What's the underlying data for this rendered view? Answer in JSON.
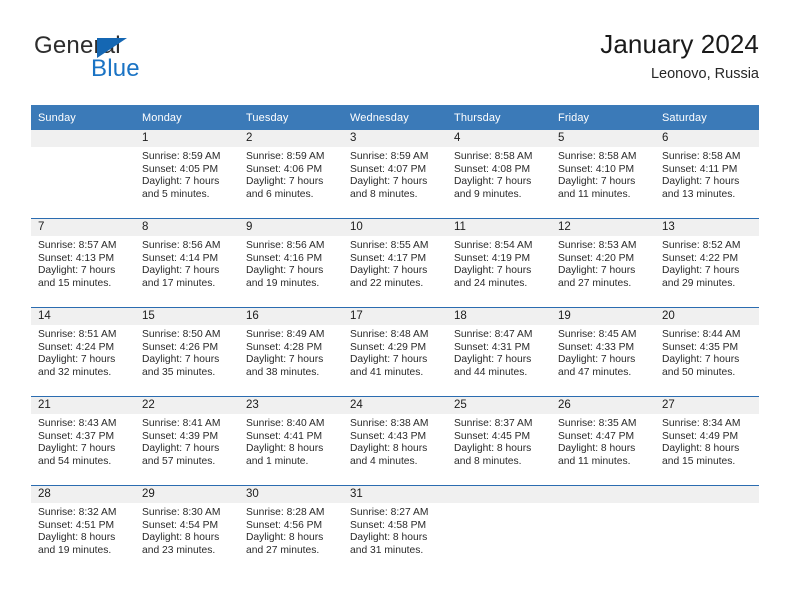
{
  "brand": {
    "name_top": "General",
    "name_bottom": "Blue",
    "triangle_color": "#1567b3",
    "blue_color": "#1a73c4"
  },
  "header": {
    "title": "January 2024",
    "location": "Leonovo, Russia"
  },
  "colors": {
    "header_blue": "#3b7ab8",
    "row_divider": "#2b6cb0",
    "daynum_band": "#f0f0f0"
  },
  "calendar": {
    "weekday_headers": [
      "Sunday",
      "Monday",
      "Tuesday",
      "Wednesday",
      "Thursday",
      "Friday",
      "Saturday"
    ],
    "weeks": [
      [
        {
          "day": "",
          "empty": true,
          "lines": []
        },
        {
          "day": "1",
          "lines": [
            "Sunrise: 8:59 AM",
            "Sunset: 4:05 PM",
            "Daylight: 7 hours",
            "and 5 minutes."
          ]
        },
        {
          "day": "2",
          "lines": [
            "Sunrise: 8:59 AM",
            "Sunset: 4:06 PM",
            "Daylight: 7 hours",
            "and 6 minutes."
          ]
        },
        {
          "day": "3",
          "lines": [
            "Sunrise: 8:59 AM",
            "Sunset: 4:07 PM",
            "Daylight: 7 hours",
            "and 8 minutes."
          ]
        },
        {
          "day": "4",
          "lines": [
            "Sunrise: 8:58 AM",
            "Sunset: 4:08 PM",
            "Daylight: 7 hours",
            "and 9 minutes."
          ]
        },
        {
          "day": "5",
          "lines": [
            "Sunrise: 8:58 AM",
            "Sunset: 4:10 PM",
            "Daylight: 7 hours",
            "and 11 minutes."
          ]
        },
        {
          "day": "6",
          "lines": [
            "Sunrise: 8:58 AM",
            "Sunset: 4:11 PM",
            "Daylight: 7 hours",
            "and 13 minutes."
          ]
        }
      ],
      [
        {
          "day": "7",
          "lines": [
            "Sunrise: 8:57 AM",
            "Sunset: 4:13 PM",
            "Daylight: 7 hours",
            "and 15 minutes."
          ]
        },
        {
          "day": "8",
          "lines": [
            "Sunrise: 8:56 AM",
            "Sunset: 4:14 PM",
            "Daylight: 7 hours",
            "and 17 minutes."
          ]
        },
        {
          "day": "9",
          "lines": [
            "Sunrise: 8:56 AM",
            "Sunset: 4:16 PM",
            "Daylight: 7 hours",
            "and 19 minutes."
          ]
        },
        {
          "day": "10",
          "lines": [
            "Sunrise: 8:55 AM",
            "Sunset: 4:17 PM",
            "Daylight: 7 hours",
            "and 22 minutes."
          ]
        },
        {
          "day": "11",
          "lines": [
            "Sunrise: 8:54 AM",
            "Sunset: 4:19 PM",
            "Daylight: 7 hours",
            "and 24 minutes."
          ]
        },
        {
          "day": "12",
          "lines": [
            "Sunrise: 8:53 AM",
            "Sunset: 4:20 PM",
            "Daylight: 7 hours",
            "and 27 minutes."
          ]
        },
        {
          "day": "13",
          "lines": [
            "Sunrise: 8:52 AM",
            "Sunset: 4:22 PM",
            "Daylight: 7 hours",
            "and 29 minutes."
          ]
        }
      ],
      [
        {
          "day": "14",
          "lines": [
            "Sunrise: 8:51 AM",
            "Sunset: 4:24 PM",
            "Daylight: 7 hours",
            "and 32 minutes."
          ]
        },
        {
          "day": "15",
          "lines": [
            "Sunrise: 8:50 AM",
            "Sunset: 4:26 PM",
            "Daylight: 7 hours",
            "and 35 minutes."
          ]
        },
        {
          "day": "16",
          "lines": [
            "Sunrise: 8:49 AM",
            "Sunset: 4:28 PM",
            "Daylight: 7 hours",
            "and 38 minutes."
          ]
        },
        {
          "day": "17",
          "lines": [
            "Sunrise: 8:48 AM",
            "Sunset: 4:29 PM",
            "Daylight: 7 hours",
            "and 41 minutes."
          ]
        },
        {
          "day": "18",
          "lines": [
            "Sunrise: 8:47 AM",
            "Sunset: 4:31 PM",
            "Daylight: 7 hours",
            "and 44 minutes."
          ]
        },
        {
          "day": "19",
          "lines": [
            "Sunrise: 8:45 AM",
            "Sunset: 4:33 PM",
            "Daylight: 7 hours",
            "and 47 minutes."
          ]
        },
        {
          "day": "20",
          "lines": [
            "Sunrise: 8:44 AM",
            "Sunset: 4:35 PM",
            "Daylight: 7 hours",
            "and 50 minutes."
          ]
        }
      ],
      [
        {
          "day": "21",
          "lines": [
            "Sunrise: 8:43 AM",
            "Sunset: 4:37 PM",
            "Daylight: 7 hours",
            "and 54 minutes."
          ]
        },
        {
          "day": "22",
          "lines": [
            "Sunrise: 8:41 AM",
            "Sunset: 4:39 PM",
            "Daylight: 7 hours",
            "and 57 minutes."
          ]
        },
        {
          "day": "23",
          "lines": [
            "Sunrise: 8:40 AM",
            "Sunset: 4:41 PM",
            "Daylight: 8 hours",
            "and 1 minute."
          ]
        },
        {
          "day": "24",
          "lines": [
            "Sunrise: 8:38 AM",
            "Sunset: 4:43 PM",
            "Daylight: 8 hours",
            "and 4 minutes."
          ]
        },
        {
          "day": "25",
          "lines": [
            "Sunrise: 8:37 AM",
            "Sunset: 4:45 PM",
            "Daylight: 8 hours",
            "and 8 minutes."
          ]
        },
        {
          "day": "26",
          "lines": [
            "Sunrise: 8:35 AM",
            "Sunset: 4:47 PM",
            "Daylight: 8 hours",
            "and 11 minutes."
          ]
        },
        {
          "day": "27",
          "lines": [
            "Sunrise: 8:34 AM",
            "Sunset: 4:49 PM",
            "Daylight: 8 hours",
            "and 15 minutes."
          ]
        }
      ],
      [
        {
          "day": "28",
          "lines": [
            "Sunrise: 8:32 AM",
            "Sunset: 4:51 PM",
            "Daylight: 8 hours",
            "and 19 minutes."
          ]
        },
        {
          "day": "29",
          "lines": [
            "Sunrise: 8:30 AM",
            "Sunset: 4:54 PM",
            "Daylight: 8 hours",
            "and 23 minutes."
          ]
        },
        {
          "day": "30",
          "lines": [
            "Sunrise: 8:28 AM",
            "Sunset: 4:56 PM",
            "Daylight: 8 hours",
            "and 27 minutes."
          ]
        },
        {
          "day": "31",
          "lines": [
            "Sunrise: 8:27 AM",
            "Sunset: 4:58 PM",
            "Daylight: 8 hours",
            "and 31 minutes."
          ]
        },
        {
          "day": "",
          "empty": true,
          "lines": []
        },
        {
          "day": "",
          "empty": true,
          "lines": []
        },
        {
          "day": "",
          "empty": true,
          "lines": []
        }
      ]
    ]
  }
}
